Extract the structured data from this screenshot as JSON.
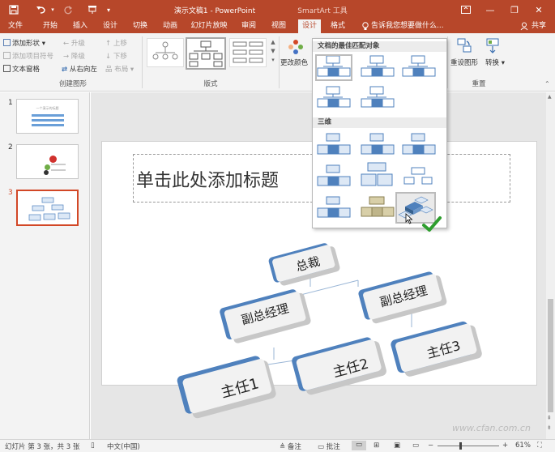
{
  "titlebar": {
    "title": "演示文稿1 - PowerPoint",
    "context_tool": "SmartArt 工具",
    "minimize": "—",
    "restore": "❐",
    "close": "✕"
  },
  "tabs": {
    "file": "文件",
    "home": "开始",
    "insert": "插入",
    "design": "设计",
    "transitions": "切换",
    "animations": "动画",
    "slideshow": "幻灯片放映",
    "review": "审阅",
    "view": "视图",
    "sa_design": "设计",
    "sa_format": "格式",
    "tell_me": "告诉我您想要做什么...",
    "share": "共享"
  },
  "ribbon": {
    "add_shape": "添加形状",
    "add_bullet": "添加项目符号",
    "text_pane": "文本窗格",
    "promote": "升级",
    "demote": "降级",
    "rtl": "从右向左",
    "move_up": "上移",
    "move_down": "下移",
    "layout": "布局",
    "group_create": "创建图形",
    "group_layouts": "版式",
    "change_colors": "更改颜色",
    "reset_graphic": "重设图形",
    "convert": "转换",
    "group_reset": "重置"
  },
  "gallery": {
    "section_best": "文档的最佳匹配对象",
    "section_3d": "三维"
  },
  "slides": {
    "numbers": [
      "1",
      "2",
      "3"
    ],
    "thumb1_title": "一个演示的标题",
    "thumb3_top": "总裁"
  },
  "slide": {
    "title_placeholder": "单击此处添加标题",
    "nodes": {
      "ceo": "总裁",
      "vp1": "副总经理",
      "vp2": "副总经理",
      "m1": "主任1",
      "m2": "主任2",
      "m3": "主任3"
    }
  },
  "status": {
    "slide_info": "幻灯片 第 3 张，共 3 张",
    "language": "中文(中国)",
    "notes": "备注",
    "comments": "批注",
    "zoom": "61%",
    "watermark": "www.cfan.com.cn"
  },
  "colors": {
    "accent": "#b7472a",
    "node_blue": "#4f81bd",
    "check_green": "#2e9e2e"
  }
}
